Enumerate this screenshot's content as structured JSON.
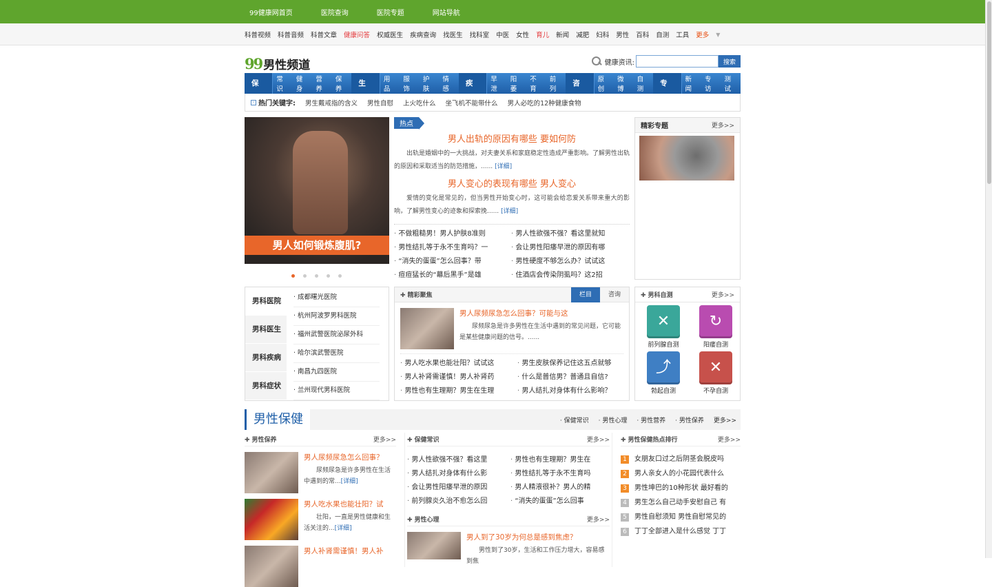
{
  "topbar": {
    "items": [
      "99健康网首页",
      "医院查询",
      "医院专题",
      "网站导航"
    ]
  },
  "subnav": {
    "items": [
      "科普视频",
      "科普音频",
      "科普文章",
      "健康问答",
      "权威医生",
      "疾病查询",
      "找医生",
      "找科室",
      "中医",
      "女性",
      "育儿",
      "新闻",
      "减肥",
      "妇科",
      "男性",
      "百科",
      "自测",
      "工具"
    ],
    "highlight": [
      "健康问答",
      "育儿"
    ],
    "more": "更多"
  },
  "logo": {
    "num": "99",
    "title": "男性频道"
  },
  "search": {
    "label": "健康资讯:",
    "placeholder": "",
    "button": "搜索"
  },
  "channel_nav": [
    {
      "cat": "保健",
      "links": [
        "常识",
        "健身",
        "营养",
        "保养"
      ]
    },
    {
      "cat": "生活",
      "links": [
        "用品",
        "服饰",
        "护肤",
        "情感"
      ]
    },
    {
      "cat": "疾病",
      "links": [
        "早泄",
        "阳萎",
        "不育",
        "前列"
      ]
    },
    {
      "cat": "咨询",
      "links": [
        "原创",
        "微博",
        "自测"
      ]
    },
    {
      "cat": "专题",
      "links": [
        "新闻",
        "专访",
        "测试"
      ]
    }
  ],
  "hot": {
    "label": "热门关键字:",
    "items": [
      "男生戴戒指的含义",
      "男性自慰",
      "上火吃什么",
      "坐飞机不能带什么",
      "男人必吃的12种健康食物"
    ]
  },
  "slide": {
    "caption": "男人如何锻炼腹肌?",
    "dots": 5,
    "active": 0
  },
  "headline_news": {
    "tag": "热点",
    "items": [
      {
        "title": "男人出轨的原因有哪些 要如何防",
        "summary": "出轨是婚姻中的一大挑战，对夫妻关系和家庭稳定性造成严重影响。了解男性出轨的原因和采取适当的防范措施，......",
        "more": "[详细]"
      },
      {
        "title": "男人变心的表现有哪些 男人变心",
        "summary": "爱情的变化是常见的，但当男性开始变心时，这可能会给恋爱关系带来重大的影响，了解男性变心的迹象和探索挽......",
        "more": "[详细]"
      }
    ],
    "list": [
      "不做粗糙男！男人护肤8准则",
      "男人性欲强不强？看这里就知",
      "男性结扎等于永不生育吗？一",
      "会让男性阳痿早泄的原因有哪",
      "“消失的蛋蛋”怎么回事？带",
      "男性硬度不够怎么办？试试这",
      "痘痘猛长的“幕后黑手”是雄",
      "住酒店会传染阴虱吗？这2招"
    ]
  },
  "special": {
    "title": "精彩专题",
    "more": "更多>>"
  },
  "hospital": {
    "cats": [
      "男科医院",
      "男科医生",
      "男科疾病",
      "男科症状"
    ],
    "items": [
      "成都曙光医院",
      "杭州阿波罗男科医院",
      "福州武警医院泌尿外科",
      "哈尔滨武警医院",
      "南昌九四医院",
      "兰州现代男科医院"
    ]
  },
  "focus": {
    "title": "精彩聚焦",
    "tabs": [
      "栏目",
      "咨询"
    ],
    "card": {
      "title": "男人尿频尿急怎么回事？可能与这",
      "desc": "尿频尿急是许多男性在生活中遇到的常见问题，它可能是某些健康问题的信号。......"
    },
    "list": [
      "男人吃水果也能壮阳？试试这",
      "男生皮肤保养记住这五点就够",
      "男人补肾需谨慎！男人补肾药",
      "什么是普信男？普通且自信?",
      "男性也有生理期？男生在生理",
      "男人结扎对身体有什么影响？"
    ]
  },
  "selftest": {
    "title": "男科自测",
    "more": "更多>>",
    "items": [
      {
        "label": "前列腺自测",
        "color": "#3aa79a",
        "icon": "x-icon"
      },
      {
        "label": "阳痿自测",
        "color": "#b94cb0",
        "icon": "arrow-curve-icon"
      },
      {
        "label": "勃起自测",
        "color": "#3f7fc4",
        "icon": "arrow-up-icon"
      },
      {
        "label": "不孕自测",
        "color": "#c7514b",
        "icon": "x-icon"
      }
    ]
  },
  "section": {
    "title": "男性保健",
    "links": [
      "保健常识",
      "男性心理",
      "男性营养",
      "男性保养"
    ],
    "more": "更多>>"
  },
  "col1": {
    "title": "男性保养",
    "more": "更多>>",
    "cards": [
      {
        "title": "男人尿频尿急怎么回事？",
        "desc": "尿频尿急是许多男性在生活中遇到的常...",
        "more": "[详细]"
      },
      {
        "title": "男人吃水果也能壮阳？试",
        "desc": "壮阳，一直是男性健康和生活关注的...",
        "more": "[详细]"
      },
      {
        "title": "男人补肾需谨慎！男人补",
        "desc": "",
        "more": ""
      }
    ]
  },
  "col2": {
    "title": "保健常识",
    "more": "更多>>",
    "list": [
      "男人性欲强不强？看这里",
      "男性也有生理期？男生在",
      "男人结扎对身体有什么影",
      "男性结扎等于永不生育吗",
      "会让男性阳痿早泄的原因",
      "男人精液很补？男人的精",
      "前列腺炎久治不愈怎么回",
      "“消失的蛋蛋”怎么回事"
    ],
    "sub_title": "男性心理",
    "sub_more": "更多>>",
    "card": {
      "title": "男人到了30岁为何总是感到焦虑？",
      "desc": "男性到了30岁，生活和工作压力增大，容易感到焦"
    }
  },
  "col3": {
    "title": "男性保健热点排行",
    "more": "更多>>",
    "list": [
      "女朋友口过之后阴茎会脱皮吗",
      "男人亲女人的小花园代表什么",
      "男性坤巴的10种形状 最好看的",
      "男生怎么自己动手安慰自己 有",
      "男性自慰须知 男性自慰常见的",
      "丁丁全部进入是什么感觉 丁丁"
    ],
    "rank_colors": [
      "#f28c28",
      "#f28c28",
      "#f28c28",
      "#bbbbbb",
      "#bbbbbb",
      "#bbbbbb"
    ]
  }
}
